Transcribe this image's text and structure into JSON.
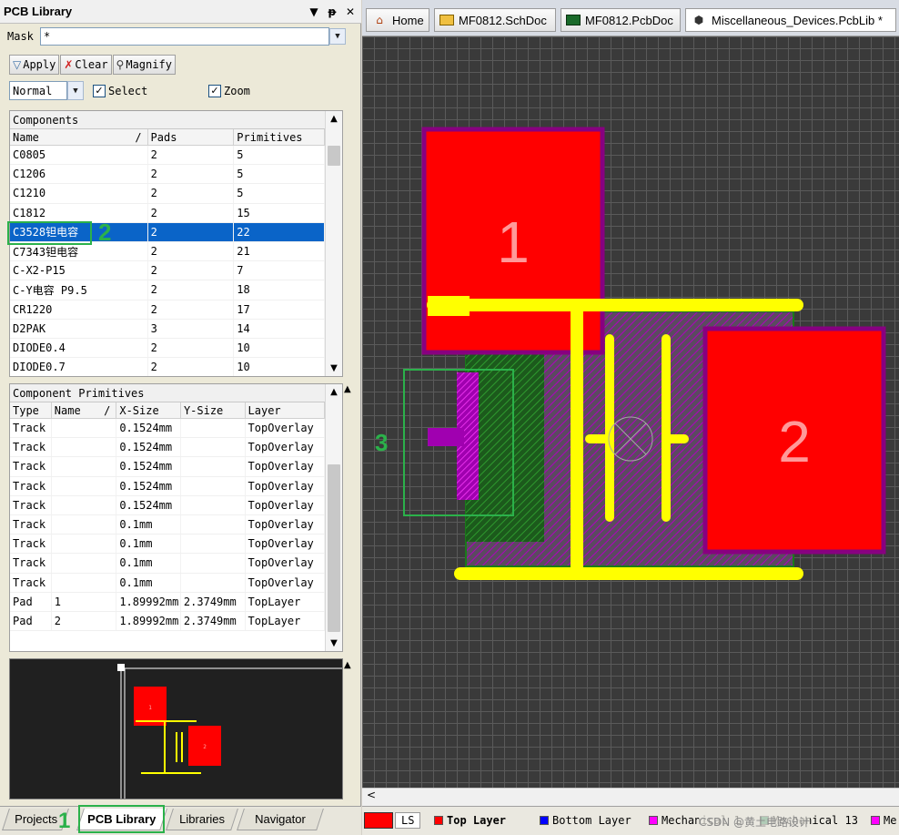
{
  "panel": {
    "title": "PCB Library",
    "title_buttons": [
      "▼",
      "ᵽ",
      "✕"
    ],
    "mask_label": "Mask",
    "mask_value": "*",
    "buttons": {
      "apply": "Apply",
      "clear": "Clear",
      "magnify": "Magnify"
    },
    "mode_value": "Normal",
    "select_label": "Select",
    "zoom_label": "Zoom",
    "select_checked": true,
    "zoom_checked": true
  },
  "components": {
    "caption": "Components",
    "columns": [
      "Name",
      "/",
      "Pads",
      "Primitives"
    ],
    "rows": [
      {
        "name": "C0805",
        "pads": "2",
        "prims": "5"
      },
      {
        "name": "C1206",
        "pads": "2",
        "prims": "5"
      },
      {
        "name": "C1210",
        "pads": "2",
        "prims": "5"
      },
      {
        "name": "C1812",
        "pads": "2",
        "prims": "15"
      },
      {
        "name": "C3528钽电容",
        "pads": "2",
        "prims": "22"
      },
      {
        "name": "C7343钽电容",
        "pads": "2",
        "prims": "21"
      },
      {
        "name": "C-X2-P15",
        "pads": "2",
        "prims": "7"
      },
      {
        "name": "C-Y电容 P9.5",
        "pads": "2",
        "prims": "18"
      },
      {
        "name": "CR1220",
        "pads": "2",
        "prims": "17"
      },
      {
        "name": "D2PAK",
        "pads": "3",
        "prims": "14"
      },
      {
        "name": "DIODE0.4",
        "pads": "2",
        "prims": "10"
      },
      {
        "name": "DIODE0.7",
        "pads": "2",
        "prims": "10"
      }
    ],
    "selected_index": 4
  },
  "primitives": {
    "caption": "Component Primitives",
    "columns": [
      "Type",
      "Name",
      "/",
      "X-Size",
      "Y-Size",
      "Layer"
    ],
    "rows": [
      {
        "type": "Track",
        "name": "",
        "x": "0.1524mm",
        "y": "",
        "layer": "TopOverlay"
      },
      {
        "type": "Track",
        "name": "",
        "x": "0.1524mm",
        "y": "",
        "layer": "TopOverlay"
      },
      {
        "type": "Track",
        "name": "",
        "x": "0.1524mm",
        "y": "",
        "layer": "TopOverlay"
      },
      {
        "type": "Track",
        "name": "",
        "x": "0.1524mm",
        "y": "",
        "layer": "TopOverlay"
      },
      {
        "type": "Track",
        "name": "",
        "x": "0.1524mm",
        "y": "",
        "layer": "TopOverlay"
      },
      {
        "type": "Track",
        "name": "",
        "x": "0.1mm",
        "y": "",
        "layer": "TopOverlay"
      },
      {
        "type": "Track",
        "name": "",
        "x": "0.1mm",
        "y": "",
        "layer": "TopOverlay"
      },
      {
        "type": "Track",
        "name": "",
        "x": "0.1mm",
        "y": "",
        "layer": "TopOverlay"
      },
      {
        "type": "Track",
        "name": "",
        "x": "0.1mm",
        "y": "",
        "layer": "TopOverlay"
      },
      {
        "type": "Pad",
        "name": "1",
        "x": "1.89992mm",
        "y": "2.3749mm",
        "layer": "TopLayer"
      },
      {
        "type": "Pad",
        "name": "2",
        "x": "1.89992mm",
        "y": "2.3749mm",
        "layer": "TopLayer"
      }
    ]
  },
  "preview": {
    "pad1": "1",
    "pad2": "2"
  },
  "bottom_tabs": [
    "Projects",
    "PCB Library",
    "Libraries",
    "Navigator"
  ],
  "active_bottom_tab": 1,
  "annotations": {
    "a1": "1",
    "a2": "2",
    "a3": "3"
  },
  "doc_tabs": [
    {
      "label": "Home",
      "icon": "home-icon"
    },
    {
      "label": "MF0812.SchDoc",
      "icon": "schematic-icon"
    },
    {
      "label": "MF0812.PcbDoc",
      "icon": "pcb-icon"
    },
    {
      "label": "Miscellaneous_Devices.PcbLib *",
      "icon": "pcblib-icon"
    }
  ],
  "footprint": {
    "pad1_label": "1",
    "pad2_label": "2"
  },
  "layers": [
    {
      "label": "LS",
      "color": "#ff0000"
    },
    {
      "label": "Top Layer",
      "color": "#ff0000"
    },
    {
      "label": "Bottom Layer",
      "color": "#0000ff"
    },
    {
      "label": "Mechanical 1",
      "color": "#ff00ff"
    },
    {
      "label": "Mechanical 13",
      "color": "#2e8b57"
    },
    {
      "label": "Me",
      "color": "#ff00ff"
    }
  ],
  "watermark": "CSDN @黄土电路设计",
  "colors": {
    "selection": "#0a64c8",
    "annotation": "#2bb14a",
    "pad": "#ff0000",
    "silk": "#ffff00",
    "mech": "#9900aa"
  }
}
